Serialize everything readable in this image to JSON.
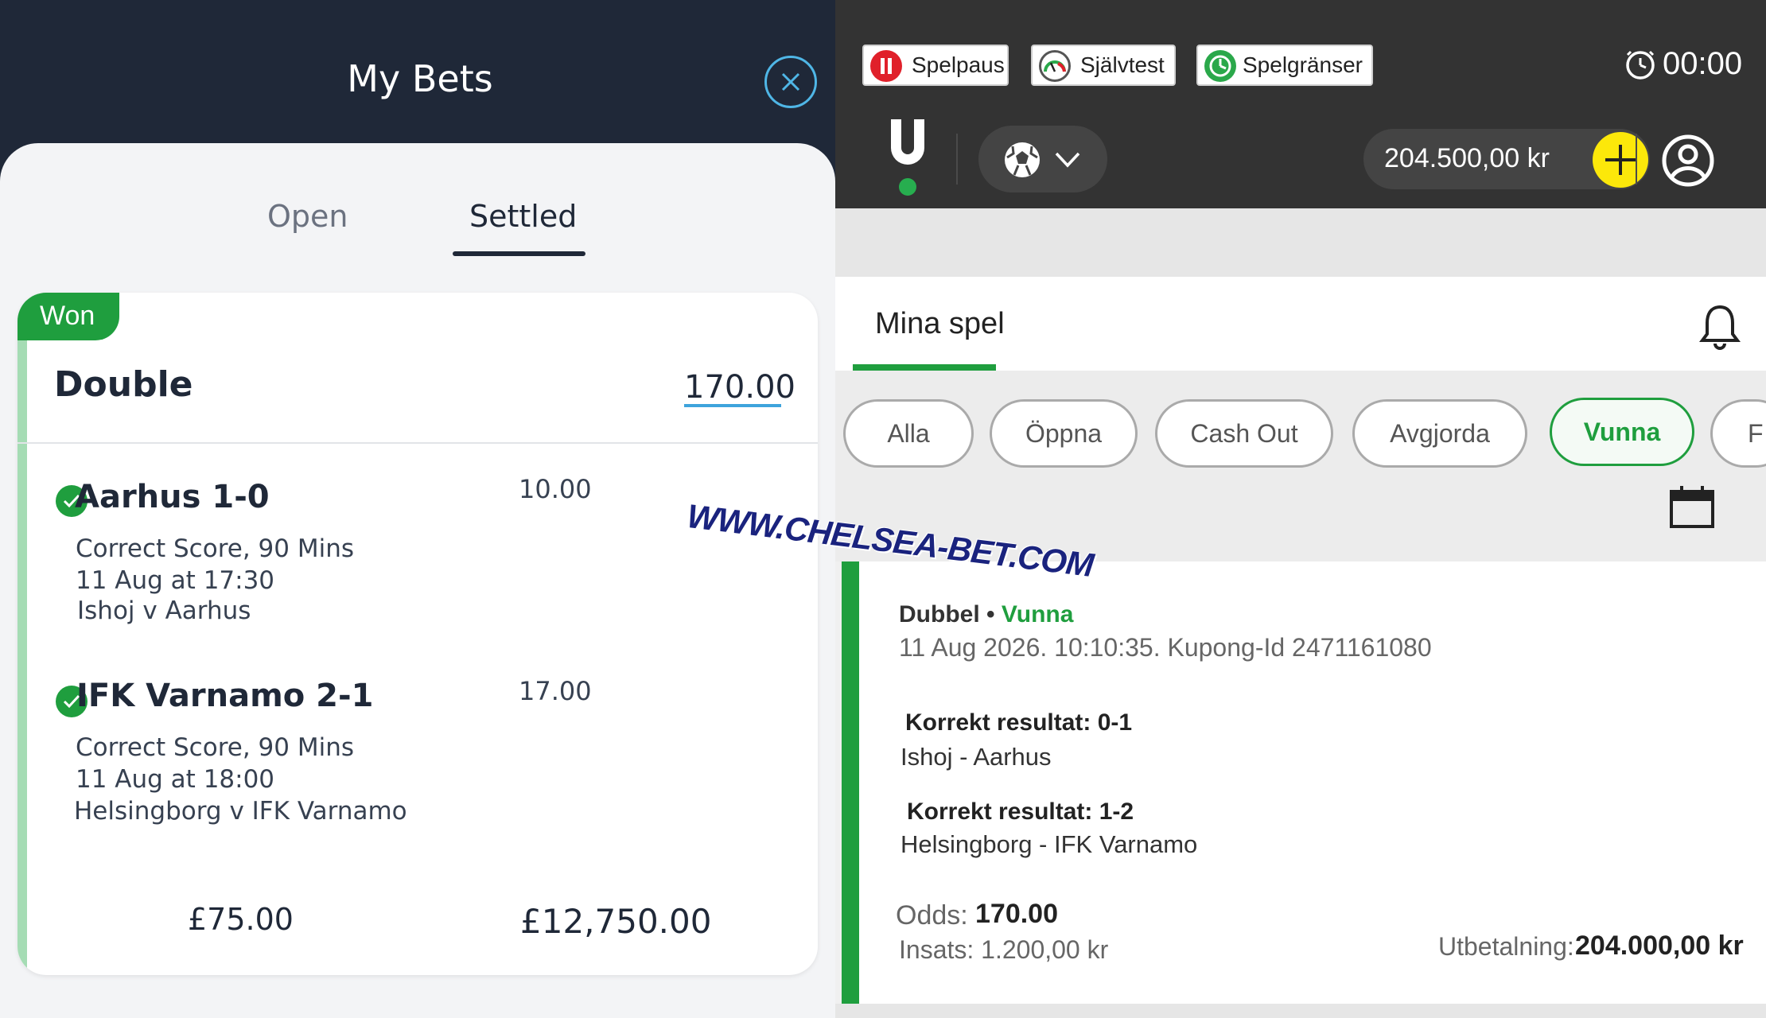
{
  "left_panel": {
    "title": "My Bets",
    "tabs": [
      {
        "label": "Open"
      },
      {
        "label": "Settled"
      }
    ],
    "bet": {
      "status_badge": "Won",
      "type": "Double",
      "total_odds": "170.00",
      "selections": [
        {
          "title": "Aarhus 1-0",
          "odds": "10.00",
          "market": "Correct Score, 90 Mins",
          "time": "11 Aug at 17:30",
          "match": "Ishoj v Aarhus"
        },
        {
          "title": "IFK Varnamo 2-1",
          "odds": "17.00",
          "market": "Correct Score, 90 Mins",
          "time": "11 Aug at 18:00",
          "match": "Helsingborg v IFK Varnamo"
        }
      ],
      "stake": "£75.00",
      "payout": "£12,750.00"
    }
  },
  "watermark": "WWW.CHELSEA-BET.COM",
  "right_panel": {
    "responsible_gaming": [
      {
        "label": "Spelpaus",
        "icon": "pause-icon"
      },
      {
        "label": "Självtest",
        "icon": "gauge-icon"
      },
      {
        "label": "Spelgränser",
        "icon": "limits-icon"
      }
    ],
    "timer": "00:00",
    "balance": "204.500,00 kr",
    "heading": "Mina spel",
    "filters": [
      {
        "label": "Alla"
      },
      {
        "label": "Öppna"
      },
      {
        "label": "Cash Out"
      },
      {
        "label": "Avgjorda"
      },
      {
        "label": "Vunna"
      },
      {
        "label": "F"
      }
    ],
    "active_filter": "Vunna",
    "bet": {
      "type": "Dubbel",
      "separator": "•",
      "status": "Vunna",
      "meta": "11 Aug 2026. 10:10:35. Kupong-Id 2471161080",
      "selections": [
        {
          "label": "Korrekt resultat: 0-1",
          "match": "Ishoj - Aarhus"
        },
        {
          "label": "Korrekt resultat: 1-2",
          "match": "Helsingborg - IFK Varnamo"
        }
      ],
      "odds_label": "Odds:",
      "odds_value": "170.00",
      "stake": "Insats: 1.200,00 kr",
      "payout_label": "Utbetalning:",
      "payout_value": "204.000,00 kr"
    },
    "colors": {
      "accent_green": "#1f9e3e",
      "add_button": "#fce80a",
      "topbar": "#333333"
    }
  },
  "colors": {
    "left_bg": "#1f2838",
    "won_green": "#1f9e3e",
    "link_blue": "#3ea3dc"
  }
}
